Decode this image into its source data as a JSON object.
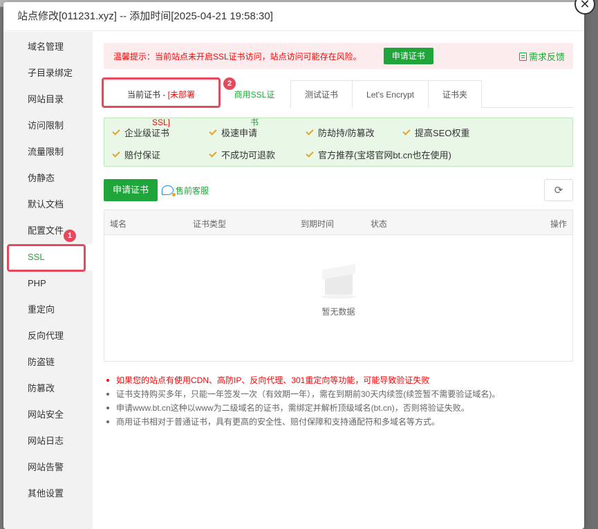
{
  "dialog": {
    "title": "站点修改[011231.xyz] -- 添加时间[2025-04-21 19:58:30]",
    "close_symbol": "✕"
  },
  "sidebar": {
    "items": [
      {
        "label": "域名管理"
      },
      {
        "label": "子目录绑定"
      },
      {
        "label": "网站目录"
      },
      {
        "label": "访问限制"
      },
      {
        "label": "流量限制"
      },
      {
        "label": "伪静态"
      },
      {
        "label": "默认文档"
      },
      {
        "label": "配置文件"
      },
      {
        "label": "SSL"
      },
      {
        "label": "PHP"
      },
      {
        "label": "重定向"
      },
      {
        "label": "反向代理"
      },
      {
        "label": "防盗链"
      },
      {
        "label": "防篡改"
      },
      {
        "label": "网站安全"
      },
      {
        "label": "网站日志"
      },
      {
        "label": "网站告警"
      },
      {
        "label": "其他设置"
      }
    ],
    "active_index": 8,
    "badge": "1"
  },
  "warning": {
    "text": "温馨提示：当前站点未开启SSL证书访问，站点访问可能存在风险。",
    "button": "申请证书",
    "feedback": "需求反馈"
  },
  "tabs": {
    "current_label": "当前证书 - ",
    "current_tag": "[未部署SSL]",
    "items": [
      "商用SSL证书",
      "测试证书",
      "Let's Encrypt",
      "证书夹"
    ],
    "badge": "2"
  },
  "benefits": [
    "企业级证书",
    "极速申请",
    "防劫持/防篡改",
    "提高SEO权重",
    "赔付保证",
    "不成功可退款",
    "官方推荐(宝塔官网bt.cn也在使用)"
  ],
  "actions": {
    "apply": "申请证书",
    "service": "售前客服",
    "refresh_symbol": "⟳"
  },
  "table": {
    "columns": [
      "域名",
      "证书类型",
      "到期时间",
      "状态",
      "操作"
    ],
    "empty_text": "暂无数据"
  },
  "notes": [
    "如果您的站点有使用CDN、高防IP、反向代理、301重定向等功能，可能导致验证失败",
    "证书支持购买多年，只能一年签发一次（有效期一年），需在到期前30天内续签(续签暂不需要验证域名)。",
    "申请www.bt.cn这种以www为二级域名的证书，需绑定并解析顶级域名(bt.cn)，否则将验证失败。",
    "商用证书相对于普通证书，具有更高的安全性、赔付保障和支持通配符和多域名等方式。"
  ],
  "colors": {
    "accent": "#20a53a",
    "danger": "#ef0808",
    "highlight": "#e34a5e"
  }
}
